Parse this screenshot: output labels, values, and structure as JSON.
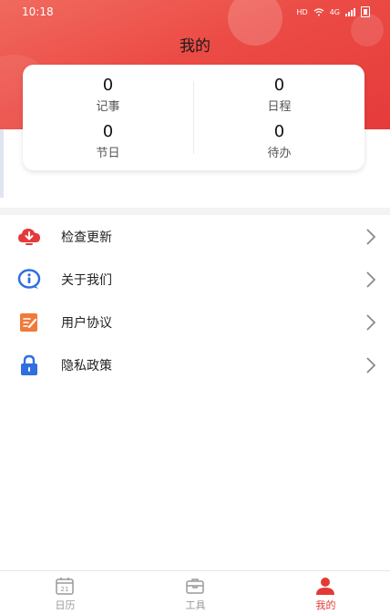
{
  "status_bar": {
    "time": "10:18",
    "hd": "HD",
    "network": "4G"
  },
  "header": {
    "title": "我的"
  },
  "stats": [
    {
      "value": "0",
      "label": "记事"
    },
    {
      "value": "0",
      "label": "日程"
    },
    {
      "value": "0",
      "label": "节日"
    },
    {
      "value": "0",
      "label": "待办"
    }
  ],
  "menu": [
    {
      "label": "检查更新",
      "icon": "cloud-download-icon",
      "color": "#e5393b"
    },
    {
      "label": "关于我们",
      "icon": "info-bubble-icon",
      "color": "#2f6fe0"
    },
    {
      "label": "用户协议",
      "icon": "edit-document-icon",
      "color": "#f07a3a"
    },
    {
      "label": "隐私政策",
      "icon": "lock-icon",
      "color": "#2f6fe0"
    }
  ],
  "tabbar": [
    {
      "label": "日历",
      "icon": "calendar-icon",
      "badge": "21"
    },
    {
      "label": "工具",
      "icon": "toolbox-icon"
    },
    {
      "label": "我的",
      "icon": "person-icon",
      "active": true
    }
  ],
  "colors": {
    "accent": "#e13a36",
    "header_red": "#ec4b45",
    "tab_inactive": "#999999"
  }
}
